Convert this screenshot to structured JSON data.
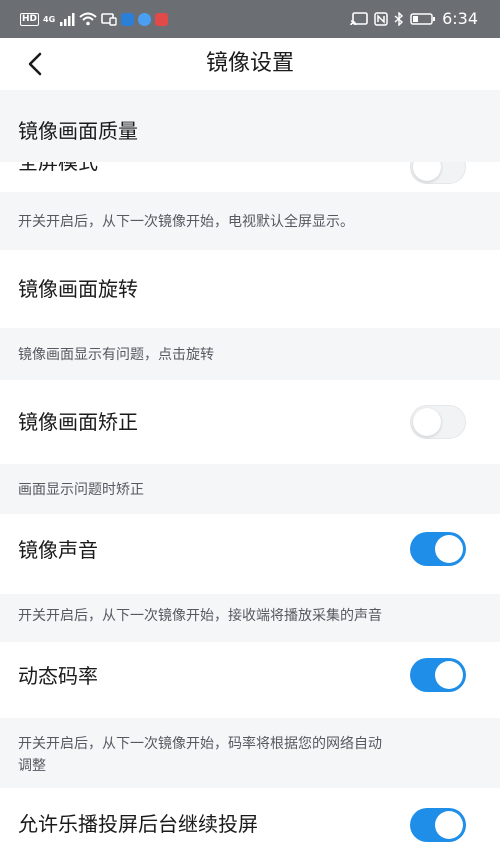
{
  "status_bar": {
    "left_tags": [
      "HD",
      "4G"
    ],
    "time": "6:34"
  },
  "nav": {
    "title": "镜像设置"
  },
  "section": {
    "title": "镜像画面质量"
  },
  "rows": [
    {
      "label": "全屏模式",
      "toggle": "off",
      "desc": "开关开启后，从下一次镜像开始，电视默认全屏显示。"
    },
    {
      "label": "镜像画面旋转",
      "toggle": null,
      "desc": "镜像画面显示有问题，点击旋转"
    },
    {
      "label": "镜像画面矫正",
      "toggle": "off",
      "desc": "画面显示问题时矫正"
    },
    {
      "label": "镜像声音",
      "toggle": "on",
      "desc": "开关开启后，从下一次镜像开始，接收端将播放采集的声音"
    },
    {
      "label": "动态码率",
      "toggle": "on",
      "desc_line1": "开关开启后，从下一次镜像开始，码率将根据您的网络自动",
      "desc_line2": "调整"
    },
    {
      "label": "允许乐播投屏后台继续投屏",
      "toggle": "on"
    }
  ],
  "colors": {
    "accent": "#1e8ee8",
    "statusbar": "#6b6f73",
    "section_bg": "#f4f6f8"
  }
}
